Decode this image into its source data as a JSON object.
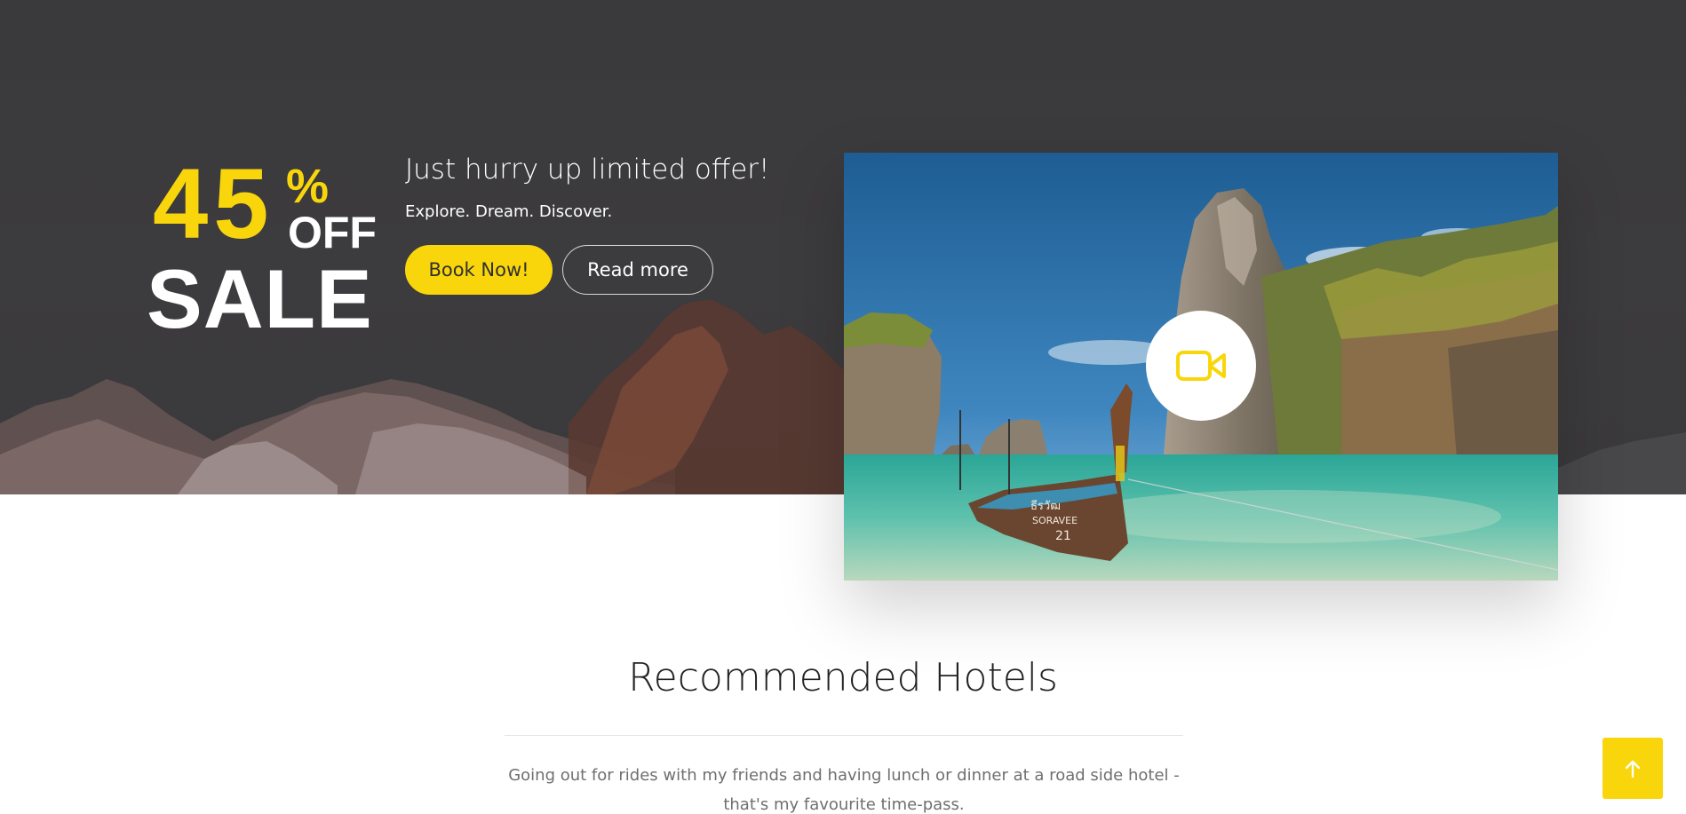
{
  "promo": {
    "discount_number": "45",
    "discount_percent": "%",
    "discount_off": "OFF",
    "sale_word": "SALE",
    "title": "Just hurry up limited offer!",
    "tagline": "Explore. Dream. Discover.",
    "book_button": "Book Now!",
    "read_button": "Read more"
  },
  "video": {
    "boat_lettering": "ธีรวัฒ SORAVEE 21",
    "play_icon": "video-camera-icon"
  },
  "section": {
    "title": "Recommended Hotels",
    "description": "Going out for rides with my friends and having lunch or dinner at a road side hotel - that's my favourite time-pass."
  },
  "back_to_top": {
    "icon": "arrow-up-icon"
  },
  "colors": {
    "accent": "#f9d60b",
    "hero_bg": "#3b3a3c",
    "text_dark": "#222222",
    "text_muted": "#6f6f6f"
  }
}
